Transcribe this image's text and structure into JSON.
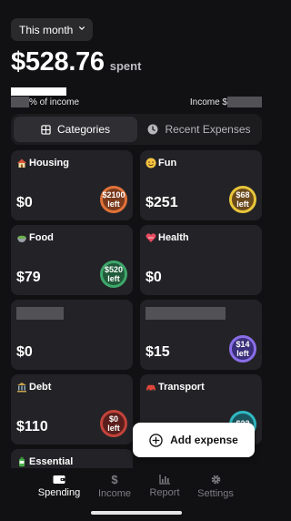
{
  "period_selector": {
    "label": "This month"
  },
  "summary": {
    "amount": "$528.76",
    "suffix": "spent",
    "progress_fraction": 0.22
  },
  "income": {
    "left_label": "% of income",
    "right_label": "Income $"
  },
  "view_toggle": {
    "categories_label": "Categories",
    "recent_label": "Recent Expenses"
  },
  "categories": [
    {
      "name": "Housing",
      "icon": "house-icon",
      "amount": "$0",
      "badge_line1": "$2100",
      "badge_line2": "left",
      "badge_color": "#e0723a",
      "badge_bg": "#7a3a1c"
    },
    {
      "name": "Fun",
      "icon": "smiley-icon",
      "amount": "$251",
      "badge_line1": "$68",
      "badge_line2": "left",
      "badge_color": "#e8c53a",
      "badge_bg": "#6b4a1c"
    },
    {
      "name": "Food",
      "icon": "bowl-icon",
      "amount": "$79",
      "badge_line1": "$520",
      "badge_line2": "left",
      "badge_color": "#3ea66a",
      "badge_bg": "#1f5a3a"
    },
    {
      "name": "Health",
      "icon": "heart-icon",
      "amount": "$0"
    },
    {
      "name": "",
      "icon": "",
      "amount": "$0"
    },
    {
      "name": "",
      "icon": "",
      "amount": "$15",
      "badge_line1": "$14",
      "badge_line2": "left",
      "badge_color": "#8a6ee8",
      "badge_bg": "#3a2f7a"
    },
    {
      "name": "Debt",
      "icon": "bank-icon",
      "amount": "$110",
      "badge_line1": "$0",
      "badge_line2": "left",
      "badge_color": "#c2433a",
      "badge_bg": "#5a1f1c"
    },
    {
      "name": "Transport",
      "icon": "car-icon",
      "amount": "",
      "badge_line1": "$22",
      "badge_line2": "",
      "badge_color": "#2fb8c2",
      "badge_bg": "#1a5560"
    },
    {
      "name": "Essential",
      "icon": "bottle-icon",
      "amount": ""
    }
  ],
  "add_expense": {
    "label": "Add expense"
  },
  "tabbar": {
    "spending": "Spending",
    "income": "Income",
    "report": "Report",
    "settings": "Settings"
  },
  "colors": {
    "background": "#111113",
    "card": "#232327",
    "accent_text": "#ffffff",
    "inactive_tab": "#7d7d83"
  }
}
